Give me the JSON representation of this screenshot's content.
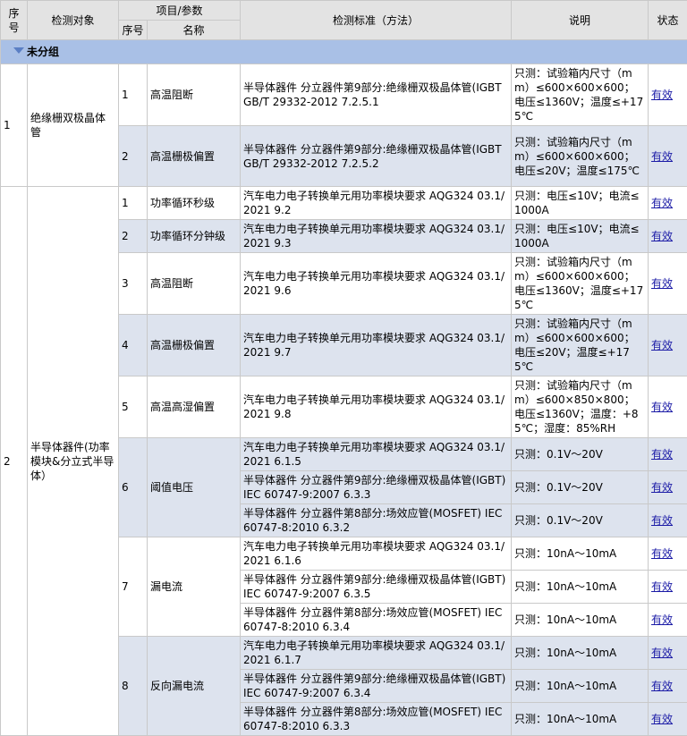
{
  "header": {
    "seq": "序号",
    "object": "检测对象",
    "item_param": "项目/参数",
    "item_seq": "序号",
    "item_name": "名称",
    "standard": "检测标准（方法）",
    "note": "说明",
    "status": "状态"
  },
  "group": {
    "label": "未分组"
  },
  "objects": [
    {
      "seq": "1",
      "name": "绝缘栅双极晶体管",
      "items": [
        {
          "seq": "1",
          "name": "高温阻断",
          "rows": [
            {
              "standard": "半导体器件 分立器件第9部分:绝缘栅双极晶体管(IGBT GB/T 29332-2012 7.2.5.1",
              "note": "只测：试验箱内尺寸（mm）≤600×600×600；电压≤1360V；温度≤+175℃",
              "status": "有效"
            }
          ]
        },
        {
          "seq": "2",
          "name": "高温栅极偏置",
          "rows": [
            {
              "standard": "半导体器件 分立器件第9部分:绝缘栅双极晶体管(IGBT GB/T 29332-2012 7.2.5.2",
              "note": "只测：试验箱内尺寸（mm）≤600×600×600；电压≤20V；温度≤175℃",
              "status": "有效"
            }
          ]
        }
      ]
    },
    {
      "seq": "2",
      "name": "半导体器件(功率模块&分立式半导体）",
      "items": [
        {
          "seq": "1",
          "name": "功率循环秒级",
          "rows": [
            {
              "standard": "汽车电力电子转换单元用功率模块要求 AQG324 03.1/2021 9.2",
              "note": "只测：电压≤10V；电流≤1000A",
              "status": "有效"
            }
          ]
        },
        {
          "seq": "2",
          "name": "功率循环分钟级",
          "rows": [
            {
              "standard": "汽车电力电子转换单元用功率模块要求 AQG324 03.1/2021 9.3",
              "note": "只测：电压≤10V；电流≤1000A",
              "status": "有效"
            }
          ]
        },
        {
          "seq": "3",
          "name": "高温阻断",
          "rows": [
            {
              "standard": "汽车电力电子转换单元用功率模块要求 AQG324 03.1/2021 9.6",
              "note": "只测：试验箱内尺寸（mm）≤600×600×600；电压≤1360V；温度≤+175℃",
              "status": "有效"
            }
          ]
        },
        {
          "seq": "4",
          "name": "高温栅极偏置",
          "rows": [
            {
              "standard": "汽车电力电子转换单元用功率模块要求 AQG324 03.1/2021 9.7",
              "note": "只测：试验箱内尺寸（mm）≤600×600×600；电压≤20V；温度≤+175℃",
              "status": "有效"
            }
          ]
        },
        {
          "seq": "5",
          "name": "高温高湿偏置",
          "rows": [
            {
              "standard": "汽车电力电子转换单元用功率模块要求 AQG324 03.1/2021 9.8",
              "note": "只测：试验箱内尺寸（mm）≤600×850×800；电压≤1360V；温度：+85℃；湿度：85%RH",
              "status": "有效"
            }
          ]
        },
        {
          "seq": "6",
          "name": "阈值电压",
          "rows": [
            {
              "standard": "汽车电力电子转换单元用功率模块要求 AQG324 03.1/2021 6.1.5",
              "note": "只测：0.1V～20V",
              "status": "有效"
            },
            {
              "standard": "半导体器件 分立器件第9部分:绝缘栅双极晶体管(IGBT) IEC 60747-9:2007 6.3.3",
              "note": "只测：0.1V～20V",
              "status": "有效"
            },
            {
              "standard": "半导体器件 分立器件第8部分:场效应管(MOSFET) IEC 60747-8:2010 6.3.2",
              "note": "只测：0.1V～20V",
              "status": "有效"
            }
          ]
        },
        {
          "seq": "7",
          "name": "漏电流",
          "rows": [
            {
              "standard": "汽车电力电子转换单元用功率模块要求 AQG324 03.1/2021 6.1.6",
              "note": "只测：10nA～10mA",
              "status": "有效"
            },
            {
              "standard": "半导体器件 分立器件第9部分:绝缘栅双极晶体管(IGBT) IEC 60747-9:2007 6.3.5",
              "note": "只测：10nA～10mA",
              "status": "有效"
            },
            {
              "standard": "半导体器件 分立器件第8部分:场效应管(MOSFET) IEC 60747-8:2010 6.3.4",
              "note": "只测：10nA～10mA",
              "status": "有效"
            }
          ]
        },
        {
          "seq": "8",
          "name": "反向漏电流",
          "rows": [
            {
              "standard": "汽车电力电子转换单元用功率模块要求 AQG324 03.1/2021 6.1.7",
              "note": "只测：10nA～10mA",
              "status": "有效"
            },
            {
              "standard": "半导体器件 分立器件第9部分:绝缘栅双极晶体管(IGBT) IEC 60747-9:2007 6.3.4",
              "note": "只测：10nA～10mA",
              "status": "有效"
            },
            {
              "standard": "半导体器件 分立器件第8部分:场效应管(MOSFET) IEC 60747-8:2010 6.3.3",
              "note": "只测：10nA～10mA",
              "status": "有效"
            }
          ]
        }
      ]
    }
  ]
}
